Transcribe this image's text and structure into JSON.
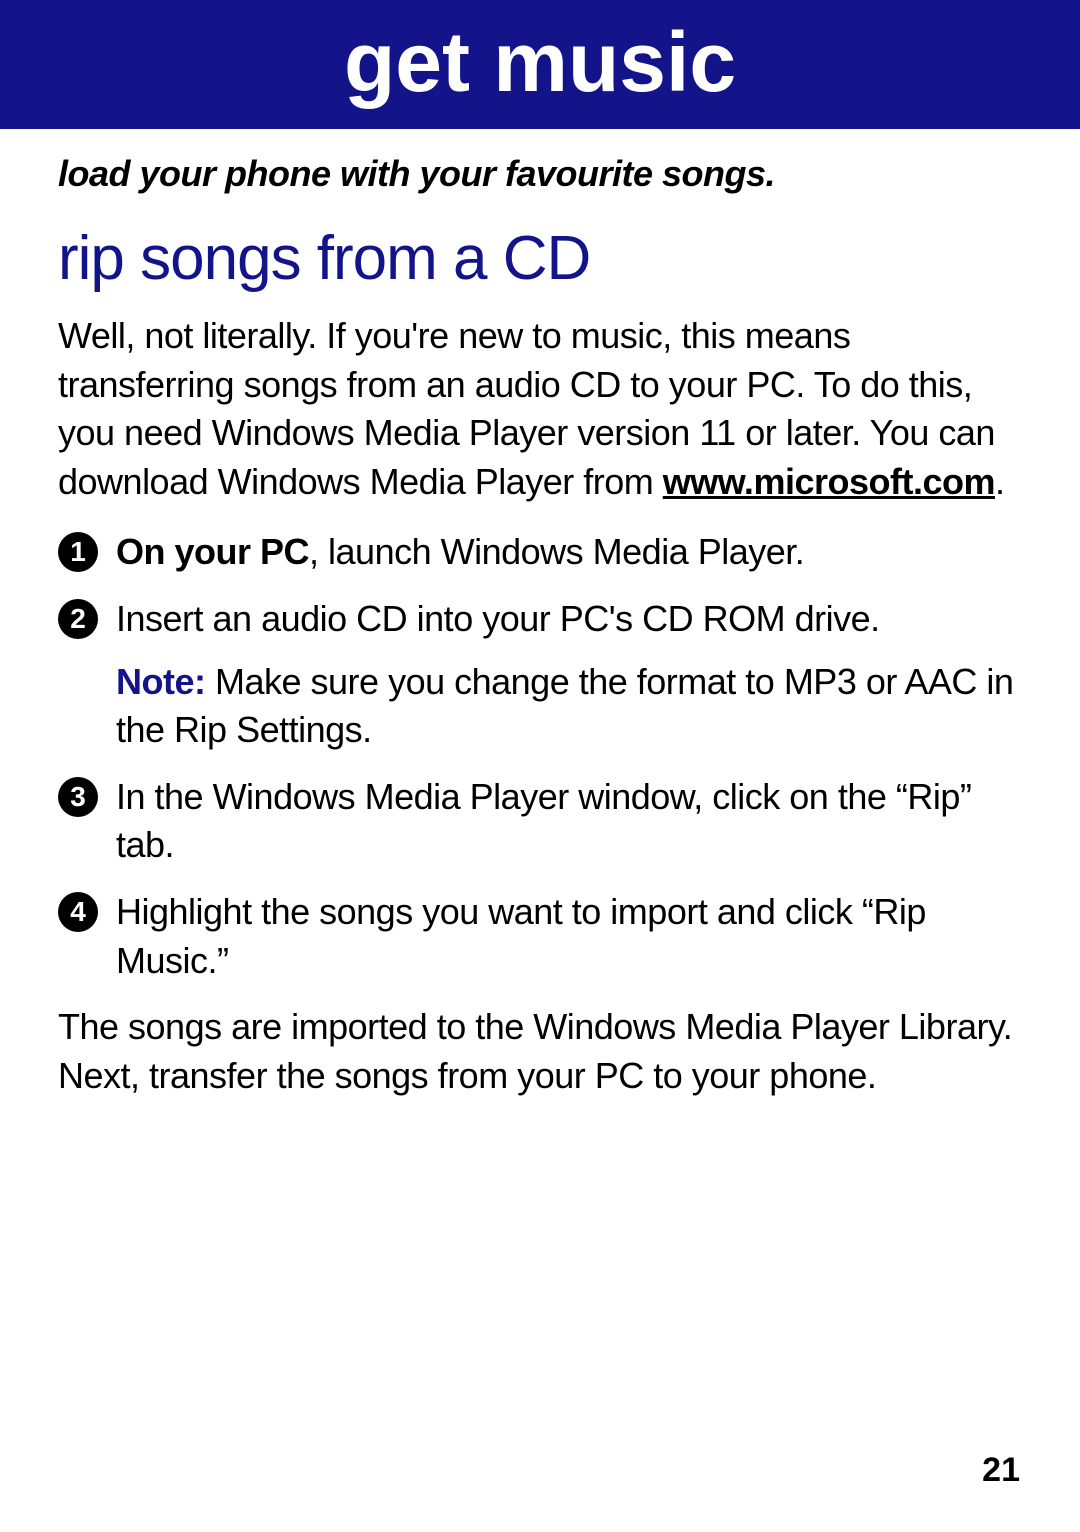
{
  "header": {
    "title": "get music"
  },
  "subtitle": "load your phone with your favourite songs.",
  "section": {
    "heading": "rip songs from a CD"
  },
  "intro": {
    "text_before_link": "Well, not literally. If you're new to music, this means transferring songs from an audio CD to your PC. To do this, you need Windows Media Player version 11 or later. You can download Windows Media Player from ",
    "link": "www.microsoft.com",
    "text_after_link": "."
  },
  "steps": [
    {
      "num": "1",
      "lead_bold": "On your PC",
      "lead_rest": ", launch Windows Media Player."
    },
    {
      "num": "2",
      "text": "Insert an audio CD into your PC's CD ROM drive.",
      "note_label": "Note:",
      "note_text": " Make sure you change the format to MP3 or AAC in the Rip Settings."
    },
    {
      "num": "3",
      "text": "In the Windows Media Player window, click on the “Rip” tab."
    },
    {
      "num": "4",
      "text": "Highlight the songs you want to import and click “Rip Music.”"
    }
  ],
  "outro": "The songs are imported to the Windows Media Player Library. Next, transfer the songs from your PC to your phone.",
  "page_number": "21"
}
